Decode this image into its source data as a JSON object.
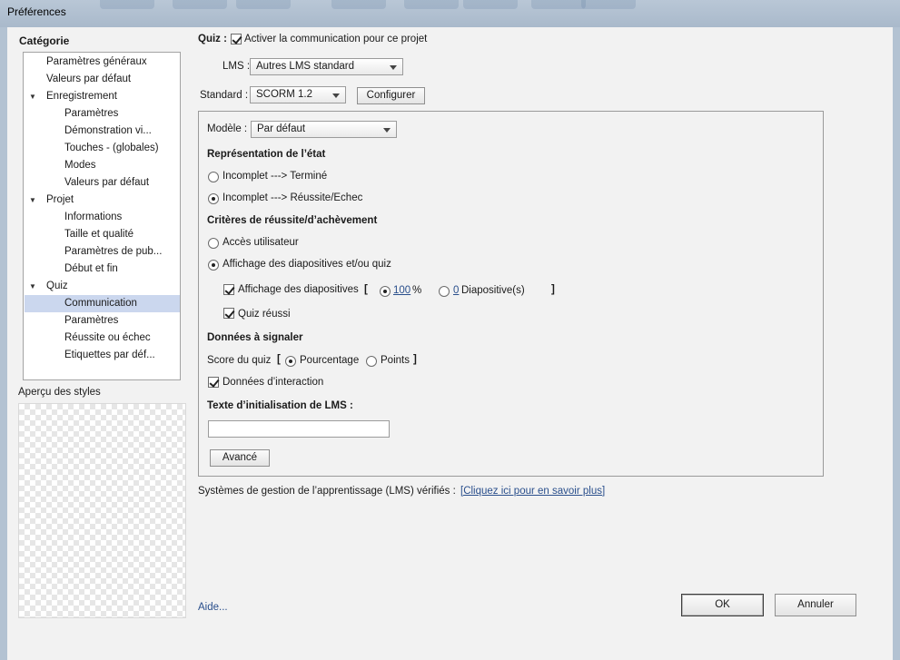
{
  "window": {
    "title": "Préférences"
  },
  "sidebar": {
    "heading": "Catégorie",
    "items": [
      {
        "label": "Paramètres généraux"
      },
      {
        "label": "Valeurs par défaut"
      },
      {
        "label": "Enregistrement"
      },
      {
        "label": "Paramètres"
      },
      {
        "label": "Démonstration vi..."
      },
      {
        "label": "Touches - (globales)"
      },
      {
        "label": "Modes"
      },
      {
        "label": "Valeurs par défaut"
      },
      {
        "label": "Projet"
      },
      {
        "label": "Informations"
      },
      {
        "label": "Taille et qualité"
      },
      {
        "label": "Paramètres de pub..."
      },
      {
        "label": "Début et fin"
      },
      {
        "label": "Quiz"
      },
      {
        "label": "Communication"
      },
      {
        "label": "Paramètres"
      },
      {
        "label": "Réussite ou échec"
      },
      {
        "label": "Etiquettes par déf..."
      }
    ],
    "selected": "Communication",
    "preview_label": "Aperçu des styles"
  },
  "main": {
    "quiz_label": "Quiz :",
    "enable_lms_label": "Activer la communication pour ce projet",
    "enable_lms_checked": true,
    "lms_label": "LMS :",
    "lms_value": "Autres LMS standard",
    "standard_label": "Standard :",
    "standard_value": "SCORM 1.2",
    "configure_button": "Configurer",
    "template_label": "Modèle :",
    "template_value": "Par défaut",
    "status_heading": "Représentation de l’état",
    "status_option_1": "Incomplet ---> Terminé",
    "status_option_2": "Incomplet ---> Réussite/Echec",
    "status_selected": 2,
    "criteria_heading": "Critères de réussite/d’achèvement",
    "criteria_option_1": "Accès utilisateur",
    "criteria_option_2": "Affichage des diapositives et/ou quiz",
    "criteria_selected": 2,
    "slide_view_label": "Affichage des diapositives",
    "slide_view_checked": true,
    "bracket_open": "[",
    "bracket_close": "]",
    "percent_value": "100",
    "percent_unit": "%",
    "slides_value": "0",
    "slides_unit": "Diapositive(s)",
    "quiz_passed_label": "Quiz réussi",
    "quiz_passed_checked": true,
    "report_heading": "Données à signaler",
    "quiz_score_label": "Score du quiz",
    "score_percent_label": "Pourcentage",
    "score_points_label": "Points",
    "score_selected": "Pourcentage",
    "interaction_label": "Données d’interaction",
    "interaction_checked": true,
    "init_text_heading": "Texte d’initialisation de LMS :",
    "init_text_value": "",
    "advanced_button": "Avancé",
    "verified_text": "Systèmes de gestion de l’apprentissage (LMS) vérifiés :",
    "verified_link": "[Cliquez ici pour en savoir plus]"
  },
  "footer": {
    "help_link": "Aide...",
    "ok_button": "OK",
    "cancel_button": "Annuler"
  }
}
